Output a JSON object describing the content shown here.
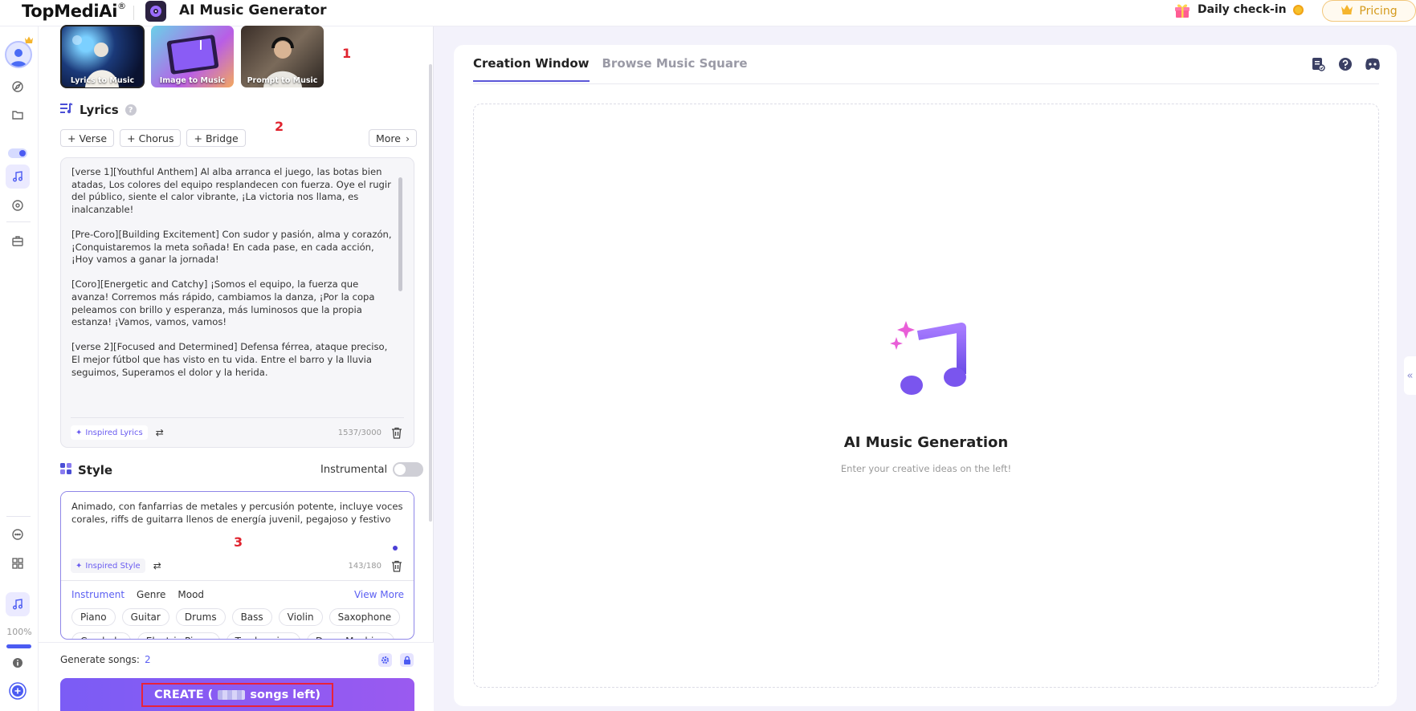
{
  "header": {
    "brand": "TopMediAi",
    "brand_mark": "®",
    "app_title": "AI Music Generator",
    "checkin": "Daily check-in",
    "pricing": "Pricing"
  },
  "rail": {
    "zoom": "100%",
    "zoom_fraction": 1.0
  },
  "modes": [
    {
      "label": "Lyrics to Music"
    },
    {
      "label": "Image to Music"
    },
    {
      "label": "Prompt to Music"
    }
  ],
  "annotations": {
    "step1": "1",
    "step2": "2",
    "step3": "3"
  },
  "lyrics": {
    "title": "Lyrics",
    "chips": [
      "Verse",
      "Chorus",
      "Bridge"
    ],
    "more": "More",
    "paragraphs": [
      "[verse 1][Youthful Anthem] Al alba arranca el juego, las botas bien atadas, Los colores del equipo resplandecen con fuerza. Oye el rugir del público, siente el calor vibrante, ¡La victoria nos llama, es inalcanzable!",
      "[Pre-Coro][Building Excitement] Con sudor y pasión, alma y corazón, ¡Conquistaremos la meta soñada! En cada pase, en cada acción, ¡Hoy vamos a ganar la jornada!",
      "[Coro][Energetic and Catchy] ¡Somos el equipo, la fuerza que avanza! Corremos más rápido, cambiamos la danza, ¡Por la copa peleamos con brillo y esperanza, más luminosos que la propia estanza! ¡Vamos, vamos, vamos!",
      "[verse 2][Focused and Determined] Defensa férrea, ataque preciso, El mejor fútbol que has visto en tu vida. Entre el barro y la lluvia seguimos, Superamos el dolor y la herida."
    ],
    "inspired": "Inspired Lyrics",
    "count": "1537/3000"
  },
  "style": {
    "title": "Style",
    "instrumental": "Instrumental",
    "text": "Animado, con fanfarrias de metales y percusión potente, incluye voces corales, riffs de guitarra llenos de energía juvenil, pegajoso y festivo",
    "inspired": "Inspired Style",
    "count": "143/180",
    "categories": [
      "Instrument",
      "Genre",
      "Mood"
    ],
    "view_more": "View More",
    "tags": [
      "Piano",
      "Guitar",
      "Drums",
      "Bass",
      "Violin",
      "Saxophone",
      "Cymbals",
      "Electric Piano",
      "Tambourine",
      "Drum Machine"
    ]
  },
  "generate": {
    "label": "Generate songs:",
    "count": "2",
    "create_prefix": "CREATE (",
    "create_suffix": "songs left)"
  },
  "main": {
    "tabs": [
      "Creation Window",
      "Browse Music Square"
    ],
    "empty_title": "AI Music Generation",
    "empty_subtitle": "Enter your creative ideas on the left!"
  },
  "colors": {
    "accent": "#5b5ff2",
    "create_gradient_start": "#7b5cf5",
    "create_gradient_end": "#9a5af0",
    "annotation_red": "#e0232e"
  }
}
